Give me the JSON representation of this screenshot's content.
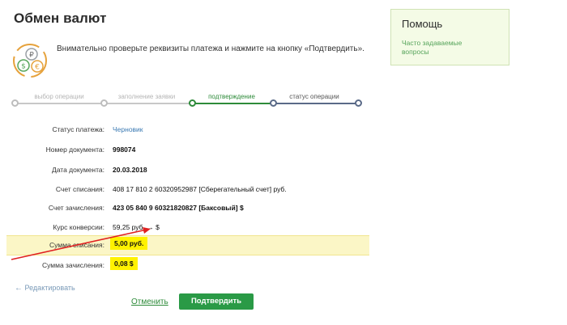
{
  "page": {
    "title": "Обмен валют",
    "intro": "Внимательно проверьте реквизиты платежа и нажмите на кнопку «Подтвердить».",
    "icon": "currency-exchange-icon"
  },
  "stepper": {
    "steps": [
      {
        "label": "выбор операции",
        "state": "done"
      },
      {
        "label": "заполнение заявки",
        "state": "done"
      },
      {
        "label": "подтверждение",
        "state": "active"
      },
      {
        "label": "статус операции",
        "state": "future"
      }
    ],
    "colors": {
      "done": "#c8c8c8",
      "active": "#2e8b3a",
      "future": "#5a6a88"
    }
  },
  "details": {
    "status": {
      "label": "Статус платежа:",
      "value": "Черновик"
    },
    "doc_number": {
      "label": "Номер документа:",
      "value": "998074"
    },
    "doc_date": {
      "label": "Дата документа:",
      "value": "20.03.2018"
    },
    "debit_account": {
      "label": "Счет списания:",
      "value": "408 17 810 2 60320952987  [Сберегательный счет]  руб."
    },
    "credit_account": {
      "label": "Счет зачисления:",
      "value": "423 05 840 9 60321820827  [Баксовый]  $"
    },
    "rate": {
      "label": "Курс конверсии:",
      "value": "59,25 руб. → $"
    },
    "debit_amount": {
      "label": "Сумма списания:",
      "value": "5,00  руб."
    },
    "credit_amount": {
      "label": "Сумма зачисления:",
      "value": "0,08  $"
    }
  },
  "actions": {
    "edit": "Редактировать",
    "cancel": "Отменить",
    "confirm": "Подтвердить"
  },
  "sidebar": {
    "title": "Помощь",
    "faq_link": "Часто задаваемые вопросы"
  },
  "colors": {
    "accent_green": "#2a9a46",
    "highlight_yellow": "#fff200",
    "annotation_red": "#e02020"
  }
}
